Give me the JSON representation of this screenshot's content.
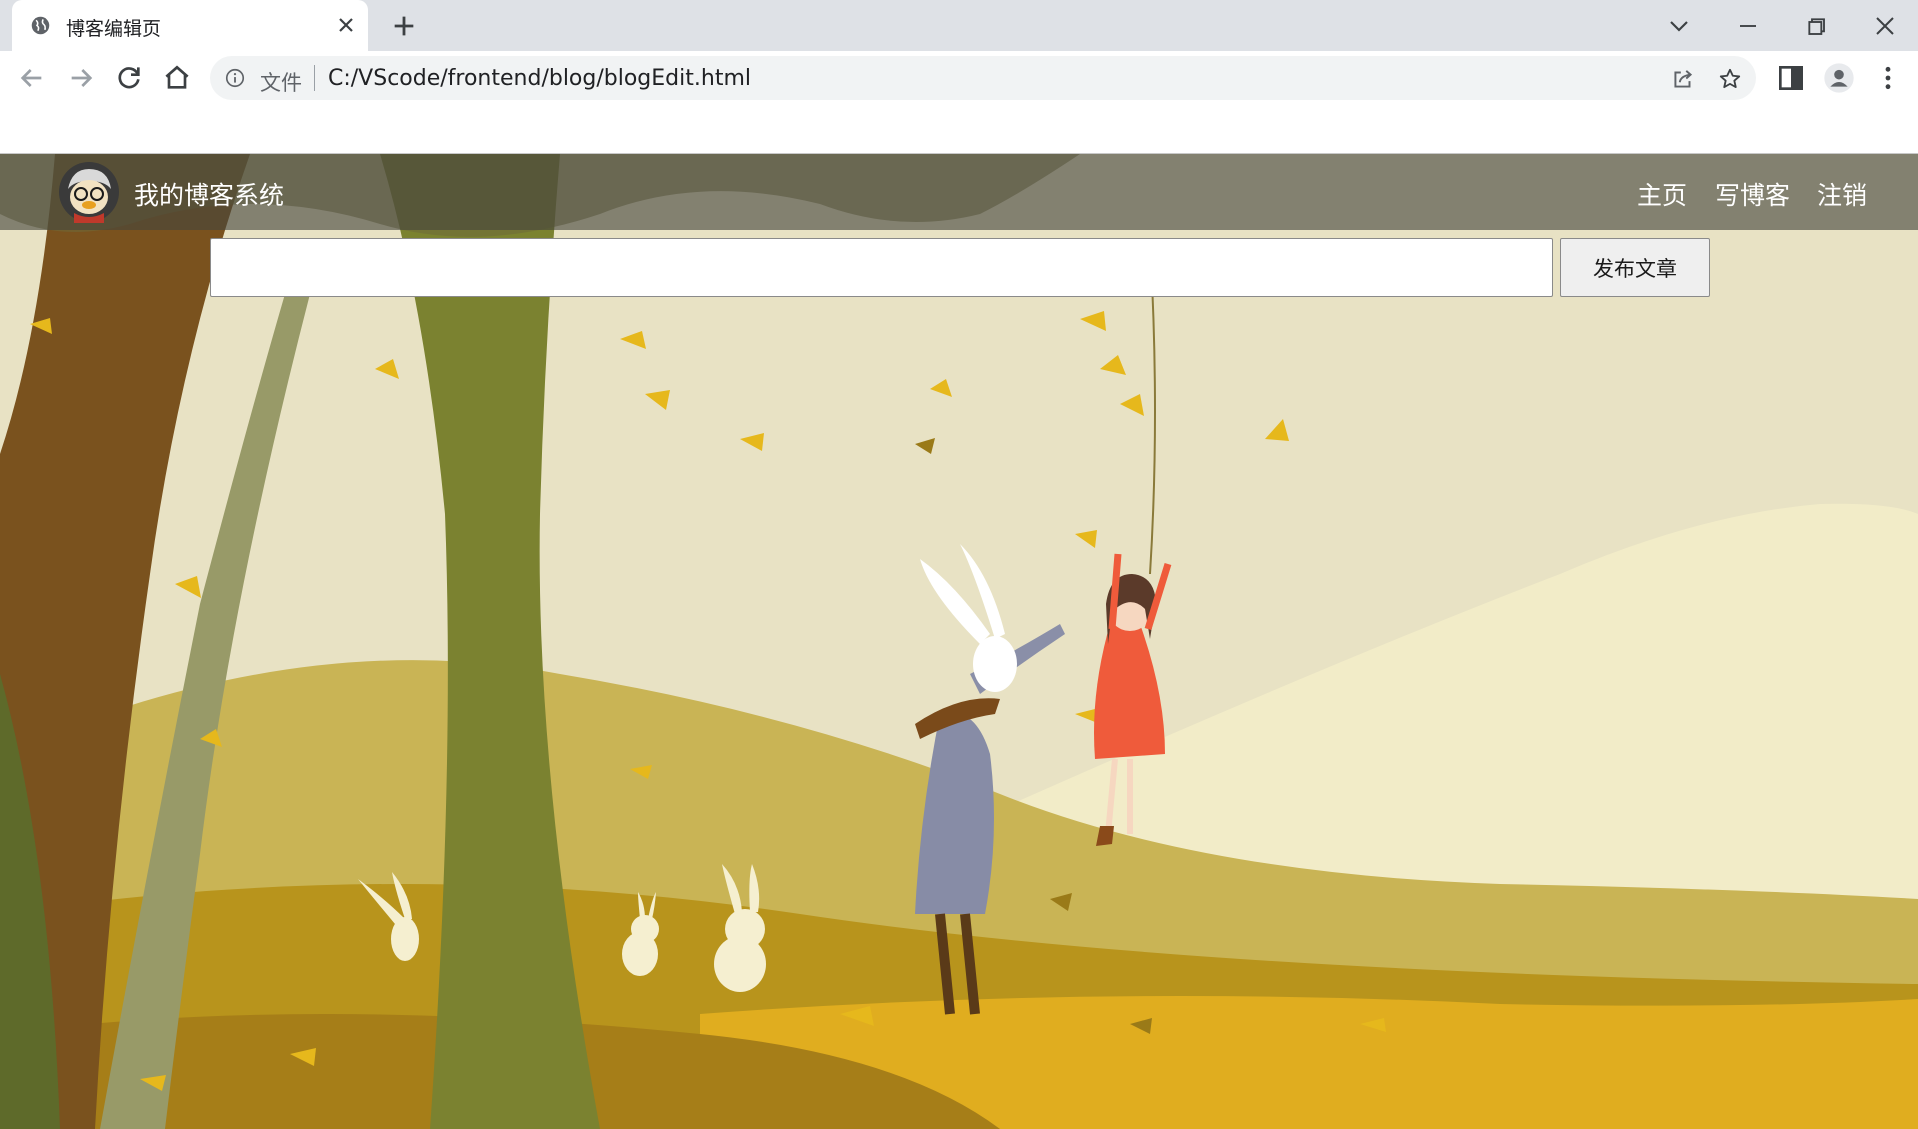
{
  "browser": {
    "tab_title": "博客编辑页",
    "scheme_label": "文件",
    "url": "C:/VScode/frontend/blog/blogEdit.html"
  },
  "site": {
    "title": "我的博客系统",
    "nav": {
      "home": "主页",
      "write": "写博客",
      "logout": "注销"
    }
  },
  "editor": {
    "title_value": "",
    "publish_label": "发布文章"
  },
  "colors": {
    "tabstrip": "#dee1e6",
    "navbar": "rgba(70,70,60,0.62)",
    "background_sky": "#e9e4c6",
    "hill_gold": "#c9a63c",
    "tree_olive": "#7b8230",
    "tree_brown": "#7a521e"
  },
  "icons": [
    "globe-icon",
    "close-icon",
    "plus-icon",
    "chevron-down-icon",
    "minimize-icon",
    "restore-icon",
    "window-close-icon",
    "back-arrow-icon",
    "forward-arrow-icon",
    "reload-icon",
    "home-icon",
    "info-icon",
    "share-icon",
    "star-icon",
    "side-panel-icon",
    "profile-icon",
    "kebab-menu-icon",
    "avatar-logo"
  ]
}
